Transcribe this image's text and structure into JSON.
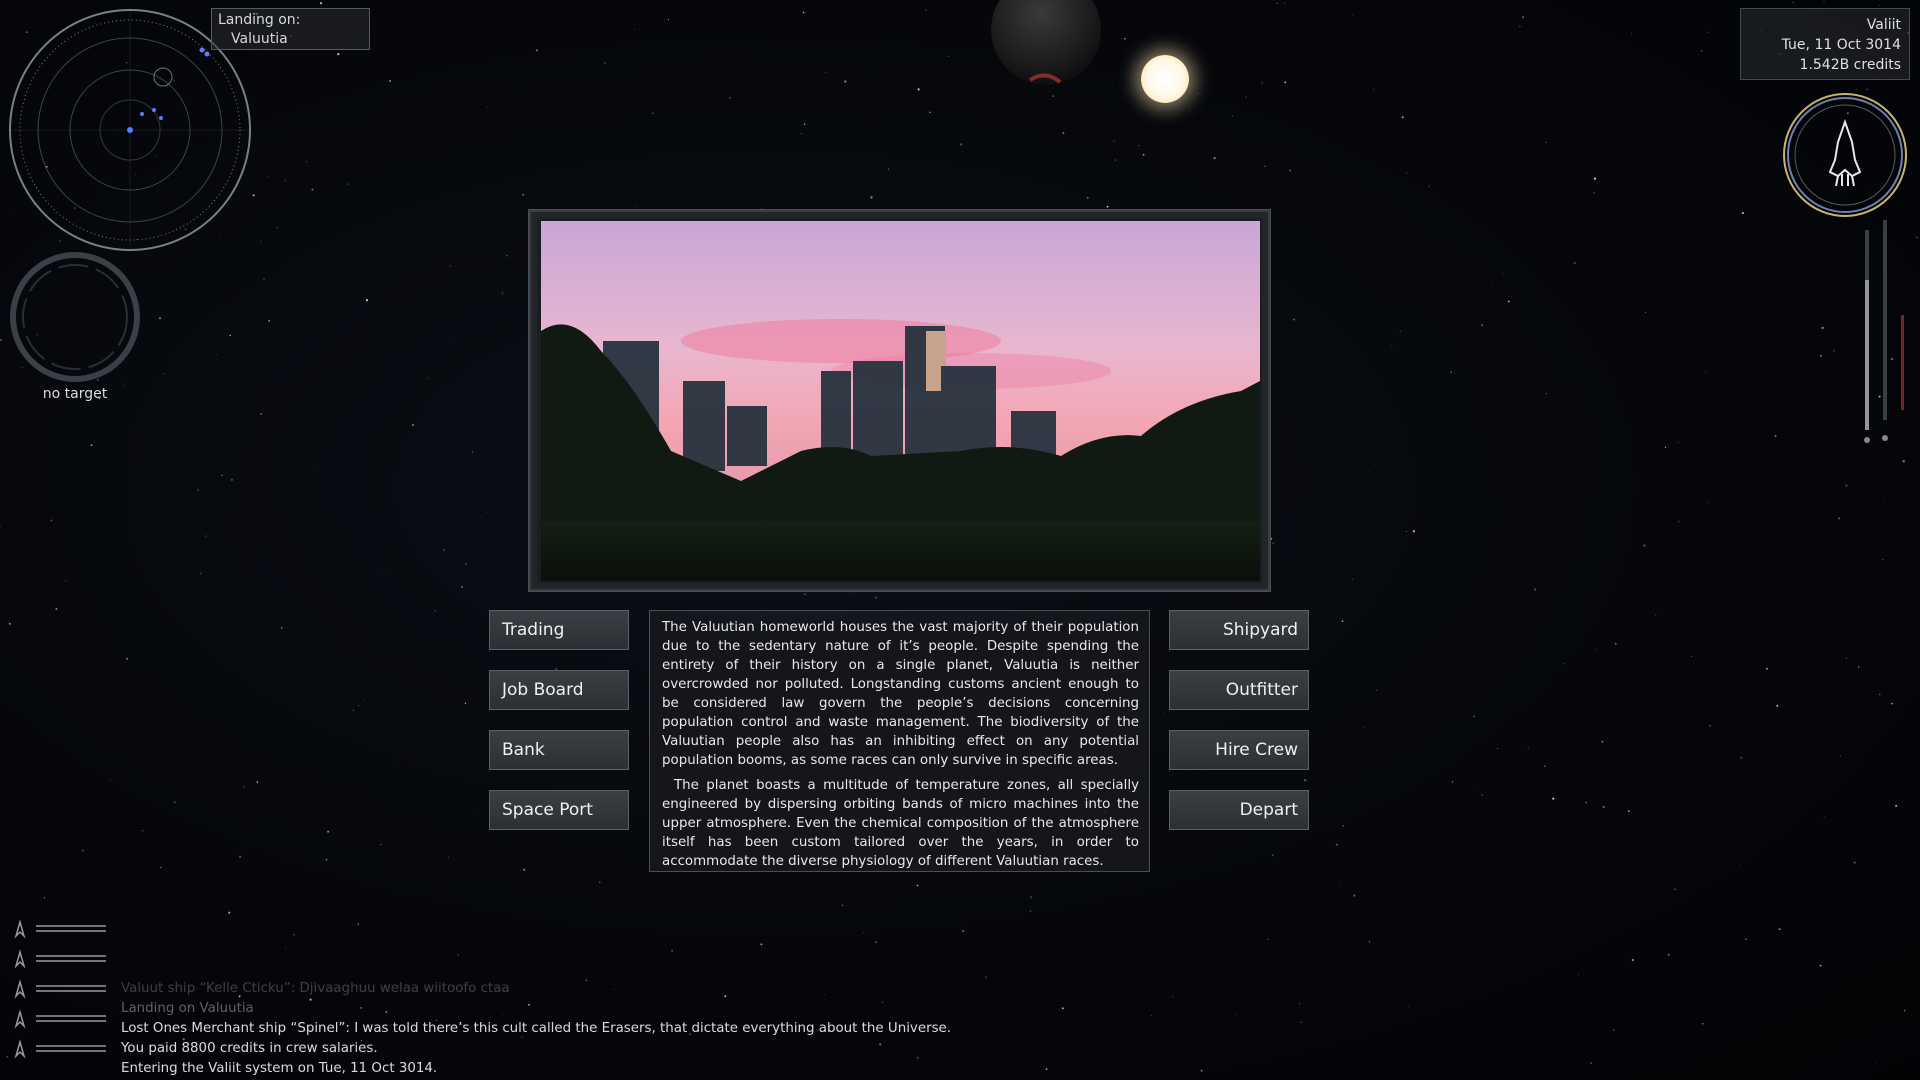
{
  "hud": {
    "landing_label": "Landing on:",
    "landing_target": "Valuutia",
    "target_status": "no target",
    "system_name": "Valiit",
    "date": "Tue, 11 Oct 3014",
    "credits": "1.542B credits"
  },
  "planet": {
    "buttons_left": [
      "Trading",
      "Job Board",
      "Bank",
      "Space Port"
    ],
    "buttons_right": [
      "Shipyard",
      "Outfitter",
      "Hire Crew",
      "Depart"
    ],
    "description": [
      "The Valuutian homeworld houses the vast majority of their population due to the sedentary nature of it’s people. Despite spending the entirety of their history on a single planet, Valuutia is neither overcrowded nor polluted. Longstanding customs ancient enough to be considered law govern the people’s decisions concerning population control and waste management. The biodiversity of the Valuutian people also has an inhibiting effect on any potential population booms, as some races can only survive in specific areas.",
      "The planet boasts a multitude of temperature zones, all specially engineered by dispersing orbiting bands of micro machines into the upper atmosphere. Even the chemical composition of the atmosphere itself has been custom tailored over the years, in order to accommodate the diverse physiology of different Valuutian races."
    ]
  },
  "log": [
    "Valuut ship “Kelle Cticku”: Djivaaghuu welaa wiitoofo ctaa",
    "Landing on Valuutia",
    "Lost Ones Merchant ship “Spinel”: I was told there’s this cult called the Erasers, that dictate everything about the Universe.",
    "You paid 8800 credits in crew salaries.",
    "Entering the Valiit system on Tue, 11 Oct 3014."
  ],
  "colors": {
    "log_opacity": [
      0.25,
      0.4,
      0.95,
      0.95,
      0.95
    ],
    "radar_ring": "#8a8f96",
    "dial_ring": "#c9b26b"
  }
}
